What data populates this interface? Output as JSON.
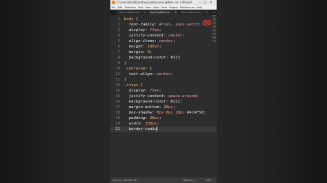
{
  "window": {
    "title": "C:\\Users\\Dell\\Desktop\\code\\LearningWeb.css • (Project) - Sublime Text",
    "controls": "–□×"
  },
  "menu": [
    "File",
    "Edit",
    "Selection",
    "Find",
    "View",
    "Goto",
    "Tools",
    "Project",
    "Preferences",
    "Help"
  ],
  "tabs": [
    {
      "label": "LearningWeb.html",
      "active": false
    },
    {
      "label": "LearningWeb.css",
      "active": true
    },
    {
      "label": "LearningPlayer.js",
      "active": false
    }
  ],
  "tab_close_glyph": "×",
  "tab_arrows": "◂ ▸",
  "editor": {
    "current_line": 21,
    "lines": [
      [
        {
          "t": "body",
          "c": "sel"
        },
        {
          "t": " {",
          "c": "punc"
        }
      ],
      [
        {
          "t": "  font-family",
          "c": "prop"
        },
        {
          "t": ": ",
          "c": "punc"
        },
        {
          "t": "Arial, sans-serif",
          "c": "val"
        },
        {
          "t": ";",
          "c": "punc"
        }
      ],
      [
        {
          "t": "  display",
          "c": "prop"
        },
        {
          "t": ": ",
          "c": "punc"
        },
        {
          "t": "flex",
          "c": "val"
        },
        {
          "t": ";",
          "c": "punc"
        }
      ],
      [
        {
          "t": "  justify-content",
          "c": "prop"
        },
        {
          "t": ": ",
          "c": "punc"
        },
        {
          "t": "center",
          "c": "val"
        },
        {
          "t": ";",
          "c": "punc"
        }
      ],
      [
        {
          "t": "  align-items",
          "c": "prop"
        },
        {
          "t": ": ",
          "c": "punc"
        },
        {
          "t": "center",
          "c": "val"
        },
        {
          "t": ";",
          "c": "punc"
        }
      ],
      [
        {
          "t": "  height",
          "c": "prop"
        },
        {
          "t": ": ",
          "c": "punc"
        },
        {
          "t": "100",
          "c": "num"
        },
        {
          "t": "vh",
          "c": "unit"
        },
        {
          "t": ";",
          "c": "punc"
        }
      ],
      [
        {
          "t": "  margin",
          "c": "prop"
        },
        {
          "t": ": ",
          "c": "punc"
        },
        {
          "t": "0",
          "c": "num"
        },
        {
          "t": ";",
          "c": "punc"
        }
      ],
      [
        {
          "t": "  background-color",
          "c": "prop"
        },
        {
          "t": ": ",
          "c": "punc"
        },
        {
          "t": "#333",
          "c": "punc"
        }
      ],
      [
        {
          "t": "}",
          "c": "punc"
        }
      ],
      [
        {
          "t": ".container",
          "c": "sel"
        },
        {
          "t": " {",
          "c": "punc"
        }
      ],
      [
        {
          "t": "  text-align",
          "c": "prop"
        },
        {
          "t": ": ",
          "c": "punc"
        },
        {
          "t": "center",
          "c": "val"
        },
        {
          "t": ";",
          "c": "punc"
        }
      ],
      [
        {
          "t": "}",
          "c": "punc"
        }
      ],
      [
        {
          "t": ".steps",
          "c": "sel"
        },
        {
          "t": " {",
          "c": "punc"
        }
      ],
      [
        {
          "t": "  display",
          "c": "prop"
        },
        {
          "t": ": ",
          "c": "punc"
        },
        {
          "t": "flex",
          "c": "val"
        },
        {
          "t": ";",
          "c": "punc"
        }
      ],
      [
        {
          "t": "  justify-content",
          "c": "prop"
        },
        {
          "t": ": ",
          "c": "punc"
        },
        {
          "t": "space-around",
          "c": "val"
        },
        {
          "t": ";",
          "c": "punc"
        }
      ],
      [
        {
          "t": "  background-color",
          "c": "prop"
        },
        {
          "t": ": ",
          "c": "punc"
        },
        {
          "t": "#222",
          "c": "punc"
        },
        {
          "t": ";",
          "c": "punc"
        }
      ],
      [
        {
          "t": "  margin-bottom",
          "c": "prop"
        },
        {
          "t": ": ",
          "c": "punc"
        },
        {
          "t": "20",
          "c": "num"
        },
        {
          "t": "px",
          "c": "unit"
        },
        {
          "t": ";",
          "c": "punc"
        }
      ],
      [
        {
          "t": "  box-shadow",
          "c": "prop"
        },
        {
          "t": ": ",
          "c": "punc"
        },
        {
          "t": "0",
          "c": "num"
        },
        {
          "t": "px",
          "c": "unit"
        },
        {
          "t": " ",
          "c": "punc"
        },
        {
          "t": "0",
          "c": "num"
        },
        {
          "t": "px",
          "c": "unit"
        },
        {
          "t": " ",
          "c": "punc"
        },
        {
          "t": "10",
          "c": "num"
        },
        {
          "t": "px",
          "c": "unit"
        },
        {
          "t": " #4CAF50",
          "c": "punc"
        },
        {
          "t": ";",
          "c": "punc"
        }
      ],
      [
        {
          "t": "  padding",
          "c": "prop"
        },
        {
          "t": ": ",
          "c": "punc"
        },
        {
          "t": "20",
          "c": "num"
        },
        {
          "t": "px",
          "c": "unit"
        },
        {
          "t": ";",
          "c": "punc"
        }
      ],
      [
        {
          "t": "  width",
          "c": "prop"
        },
        {
          "t": ": ",
          "c": "punc"
        },
        {
          "t": "330",
          "c": "num"
        },
        {
          "t": "px",
          "c": "unit"
        },
        {
          "t": ";",
          "c": "punc"
        }
      ],
      [
        {
          "t": "  border-radiu",
          "c": "prop"
        }
      ]
    ]
  },
  "status": {
    "position": "Line 21, Column 15",
    "indent": "Spaces: 2",
    "syntax": "CSS"
  }
}
